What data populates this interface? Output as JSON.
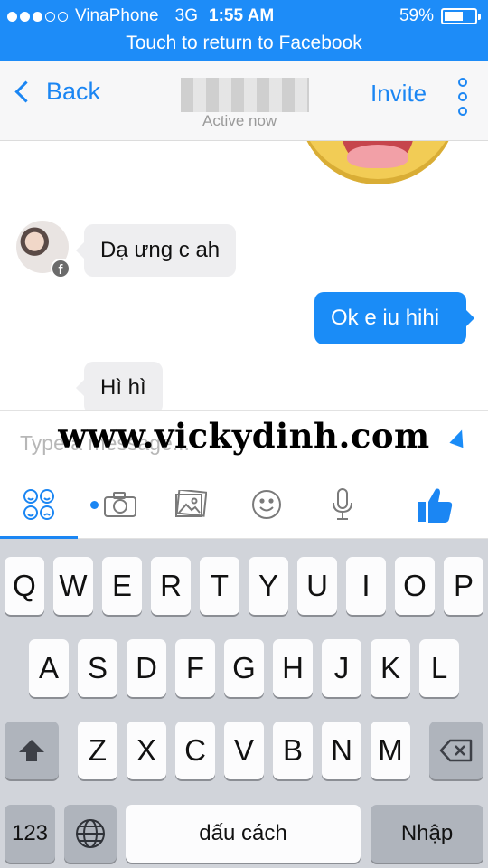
{
  "status_bar": {
    "carrier": "VinaPhone",
    "network": "3G",
    "time": "1:55 AM",
    "battery_percent": "59%",
    "battery_level": 0.59,
    "signal_bars_filled": 3,
    "signal_bars_total": 5
  },
  "return_banner": "Touch to return to Facebook",
  "nav": {
    "back_label": "Back",
    "status": "Active now",
    "invite_label": "Invite"
  },
  "messages": [
    {
      "direction": "incoming",
      "text": "Dạ ưng c ah"
    },
    {
      "direction": "outgoing",
      "text": "Ok e iu hihi"
    },
    {
      "direction": "incoming",
      "text": "Hì hì"
    }
  ],
  "composer": {
    "placeholder": "Type a message...",
    "watermark": "www.vickydinh.com"
  },
  "toolbar": {
    "icons": [
      "stickers-icon",
      "camera-icon",
      "photos-icon",
      "emoji-icon",
      "microphone-icon",
      "thumbs-up-icon"
    ]
  },
  "keyboard": {
    "row1": [
      "Q",
      "W",
      "E",
      "R",
      "T",
      "Y",
      "U",
      "I",
      "O",
      "P"
    ],
    "row2": [
      "A",
      "S",
      "D",
      "F",
      "G",
      "H",
      "J",
      "K",
      "L"
    ],
    "row3": [
      "Z",
      "X",
      "C",
      "V",
      "B",
      "N",
      "M"
    ],
    "numbers_label": "123",
    "space_label": "dấu cách",
    "return_label": "Nhập"
  },
  "colors": {
    "accent": "#1b86f3",
    "banner": "#1d8cf8",
    "outgoing_bubble": "#1a8cf7",
    "incoming_bubble": "#eeeef0",
    "keyboard_bg": "#d1d4da"
  }
}
